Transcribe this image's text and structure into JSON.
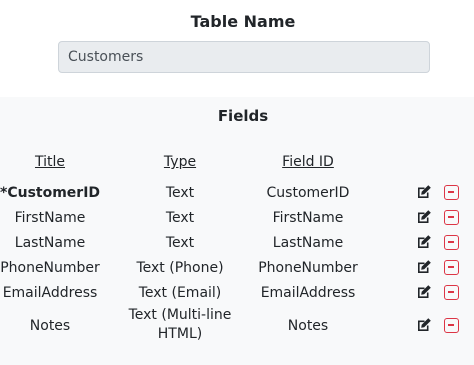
{
  "table_name": {
    "label": "Table Name",
    "value": "Customers"
  },
  "fields": {
    "title": "Fields",
    "headers": {
      "title": "Title",
      "type": "Type",
      "field_id": "Field ID"
    },
    "rows": [
      {
        "title": "*CustomerID",
        "type": "Text",
        "field_id": "CustomerID"
      },
      {
        "title": "FirstName",
        "type": "Text",
        "field_id": "FirstName"
      },
      {
        "title": "LastName",
        "type": "Text",
        "field_id": "LastName"
      },
      {
        "title": "PhoneNumber",
        "type": "Text (Phone)",
        "field_id": "PhoneNumber"
      },
      {
        "title": "EmailAddress",
        "type": "Text (Email)",
        "field_id": "EmailAddress"
      },
      {
        "title": "Notes",
        "type_line1": "Text (Multi-line",
        "type_line2": "HTML)",
        "field_id": "Notes"
      }
    ]
  },
  "icons": {
    "edit": "edit-icon",
    "delete": "minus-square-icon"
  },
  "colors": {
    "delete": "#dc3545",
    "input_bg": "#e9ecef",
    "panel_bg": "#f8f9fa"
  }
}
